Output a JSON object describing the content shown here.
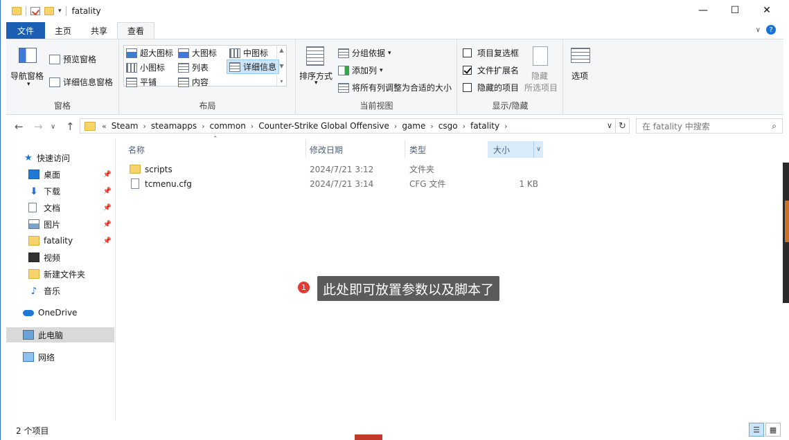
{
  "window": {
    "title": "fatality",
    "controls": {
      "minimize": "—",
      "maximize": "☐",
      "close": "✕"
    }
  },
  "ribbon_tabs": [
    "文件",
    "主页",
    "共享",
    "查看"
  ],
  "ribbon": {
    "panes_group": {
      "label": "窗格",
      "nav_pane": "导航窗格",
      "preview_pane": "预览窗格",
      "details_pane": "详细信息窗格"
    },
    "layout_group": {
      "label": "布局",
      "items": [
        "超大图标",
        "大图标",
        "中图标",
        "小图标",
        "列表",
        "详细信息",
        "平铺",
        "内容"
      ],
      "selected": "详细信息"
    },
    "current_view_group": {
      "label": "当前视图",
      "sort_by": "排序方式",
      "group_by": "分组依据",
      "add_columns": "添加列",
      "size_all_columns": "将所有列调整为合适的大小"
    },
    "show_hide_group": {
      "label": "显示/隐藏",
      "item_checkboxes": "项目复选框",
      "item_checkboxes_checked": false,
      "file_extensions": "文件扩展名",
      "file_extensions_checked": true,
      "hidden_items": "隐藏的项目",
      "hidden_items_checked": false,
      "hide_selected": "隐藏",
      "hide_selected_sub": "所选项目"
    },
    "options": {
      "label": "选项"
    }
  },
  "address": {
    "overflow": "«",
    "crumbs": [
      "Steam",
      "steamapps",
      "common",
      "Counter-Strike Global Offensive",
      "game",
      "csgo",
      "fatality"
    ]
  },
  "search": {
    "placeholder": "在 fatality 中搜索"
  },
  "nav_pane": {
    "quick_access": "快速访问",
    "items": [
      {
        "label": "桌面",
        "icon": "desktop-icon",
        "pinned": true
      },
      {
        "label": "下载",
        "icon": "download-icon",
        "pinned": true
      },
      {
        "label": "文档",
        "icon": "document-icon",
        "pinned": true
      },
      {
        "label": "图片",
        "icon": "picture-icon",
        "pinned": true
      },
      {
        "label": "fatality",
        "icon": "folder-icon",
        "pinned": true
      },
      {
        "label": "视频",
        "icon": "video-icon",
        "pinned": false
      },
      {
        "label": "新建文件夹",
        "icon": "folder-icon",
        "pinned": false
      },
      {
        "label": "音乐",
        "icon": "music-icon",
        "pinned": false
      }
    ],
    "onedrive": "OneDrive",
    "this_pc": "此电脑",
    "network": "网络"
  },
  "columns": {
    "name": "名称",
    "date": "修改日期",
    "type": "类型",
    "size": "大小"
  },
  "files": [
    {
      "name": "scripts",
      "date": "2024/7/21 3:12",
      "type": "文件夹",
      "size": "",
      "kind": "folder"
    },
    {
      "name": "tcmenu.cfg",
      "date": "2024/7/21 3:14",
      "type": "CFG 文件",
      "size": "1 KB",
      "kind": "file"
    }
  ],
  "annotation": {
    "number": "1",
    "text": "此处即可放置参数以及脚本了"
  },
  "status": {
    "item_count": "2 个项目"
  }
}
